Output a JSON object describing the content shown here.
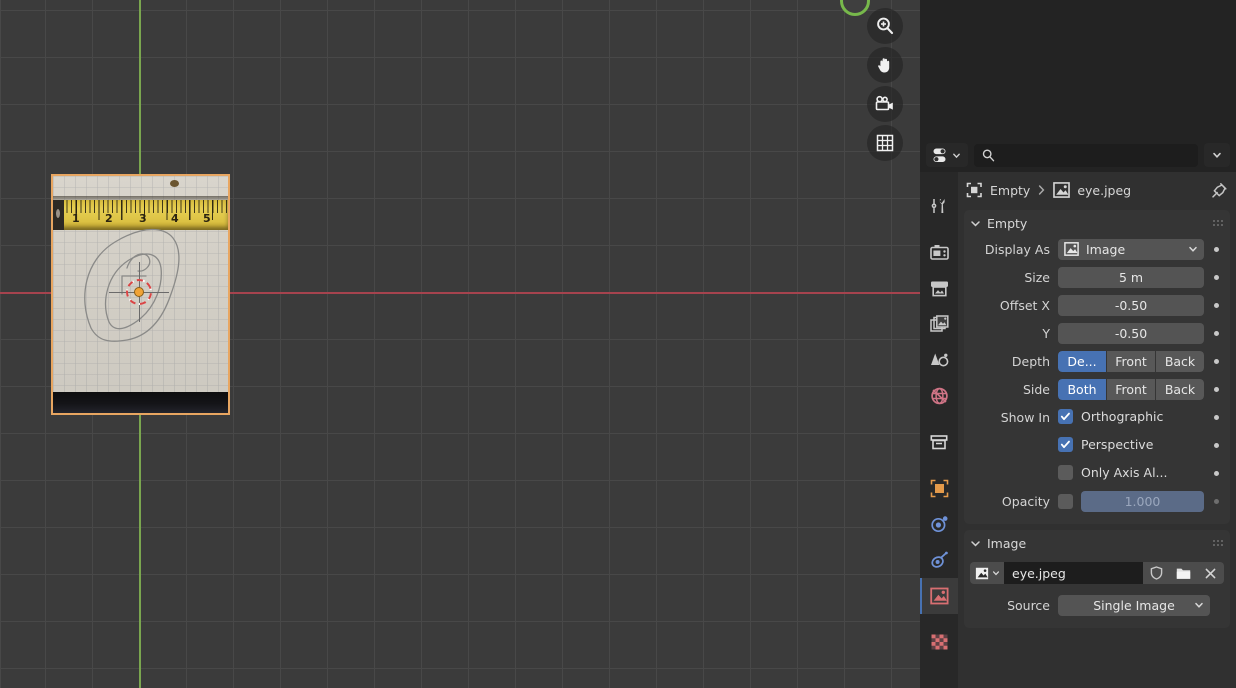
{
  "app": "Blender",
  "viewport": {
    "name": "3d-viewport",
    "background_color": "#3b3b3b",
    "grid_color": "#484848",
    "x_axis_color": "#a6434e",
    "y_axis_color": "#7aa64f",
    "gizmos": [
      {
        "name": "zoom-gizmo",
        "icon": "zoom-icon",
        "label": "Zoom"
      },
      {
        "name": "pan-gizmo",
        "icon": "hand-icon",
        "label": "Move"
      },
      {
        "name": "camera-gizmo",
        "icon": "camera-icon",
        "label": "Camera View"
      },
      {
        "name": "ortho-gizmo",
        "icon": "grid-icon",
        "label": "Toggle Orthographic"
      }
    ],
    "empty_image": {
      "name": "empty-image-object",
      "selected": true,
      "outline_color": "#e8a661",
      "tape_numbers": [
        "1",
        "2",
        "3",
        "4",
        "5"
      ]
    },
    "cursor_3d": {
      "name": "3d-cursor",
      "origin_color": "#f0a336"
    }
  },
  "properties": {
    "editor_type": {
      "label": "Properties",
      "icon": "properties-editor-icon"
    },
    "search": {
      "placeholder": "",
      "value": "",
      "icon": "search-icon"
    },
    "filter": {
      "icon": "chevron-down-icon"
    },
    "tabs": [
      {
        "name": "tool",
        "icon": "tool-icon",
        "selected": false,
        "color": "#c8c8c8"
      },
      {
        "name": "render",
        "icon": "camera-back-icon",
        "selected": false,
        "color": "#c8c8c8"
      },
      {
        "name": "output",
        "icon": "printer-icon",
        "selected": false,
        "color": "#c8c8c8"
      },
      {
        "name": "view-layer",
        "icon": "images-icon",
        "selected": false,
        "color": "#c8c8c8"
      },
      {
        "name": "scene",
        "icon": "cone-sphere-icon",
        "selected": false,
        "color": "#c8c8c8"
      },
      {
        "name": "world",
        "icon": "world-icon",
        "selected": false,
        "color": "#cf7486"
      },
      {
        "name": "collection",
        "icon": "collection-box-icon",
        "selected": false,
        "color": "#d8d8d8"
      },
      {
        "name": "object",
        "icon": "object-square-icon",
        "selected": false,
        "color": "#e49a4a"
      },
      {
        "name": "physics",
        "icon": "physics-orbit-icon",
        "selected": false,
        "color": "#6f92d8"
      },
      {
        "name": "constraints",
        "icon": "constraint-icon",
        "selected": false,
        "color": "#6f92d8"
      },
      {
        "name": "object-data",
        "icon": "image-data-icon",
        "selected": true,
        "color": "#d86f72"
      },
      {
        "name": "texture",
        "icon": "checker-icon",
        "selected": false,
        "color": "#d86f72"
      }
    ],
    "breadcrumb": [
      {
        "label": "Empty",
        "icon": "empty-object-icon"
      },
      {
        "label": "eye.jpeg",
        "icon": "image-data-icon"
      }
    ],
    "pin": {
      "name": "pin-toggle",
      "icon": "pin-icon"
    },
    "empty_panel": {
      "title": "Empty",
      "expanded": true,
      "display_as": {
        "label": "Display As",
        "value": "Image",
        "icon": "image-data-icon"
      },
      "size": {
        "label": "Size",
        "value": "5 m"
      },
      "offset_x": {
        "label": "Offset X",
        "value": "-0.50"
      },
      "offset_y": {
        "label": "Y",
        "value": "-0.50"
      },
      "depth": {
        "label": "Depth",
        "options": [
          "De...",
          "Front",
          "Back"
        ],
        "selected": 0
      },
      "side": {
        "label": "Side",
        "options": [
          "Both",
          "Front",
          "Back"
        ],
        "selected": 0
      },
      "show_in": {
        "label": "Show In",
        "items": [
          {
            "label": "Orthographic",
            "checked": true
          },
          {
            "label": "Perspective",
            "checked": true
          },
          {
            "label": "Only Axis Al...",
            "checked": false
          }
        ]
      },
      "opacity": {
        "label": "Opacity",
        "checked": false,
        "value": "1.000"
      }
    },
    "image_panel": {
      "title": "Image",
      "expanded": true,
      "datablock": {
        "name": "eye.jpeg",
        "browse_icon": "image-data-icon",
        "fake_user_icon": "shield-icon",
        "open_icon": "folder-icon",
        "unlink_icon": "close-icon"
      },
      "source": {
        "label": "Source",
        "value": "Single Image"
      }
    },
    "accent_color": "#4772b3"
  }
}
